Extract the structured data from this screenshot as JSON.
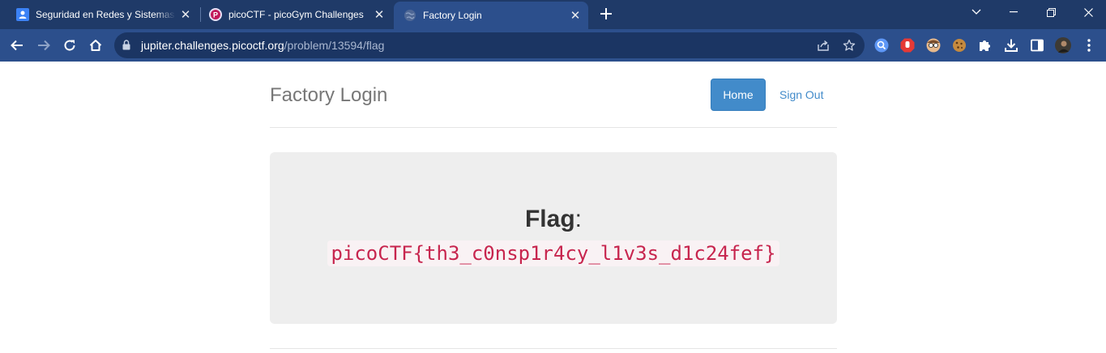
{
  "browser": {
    "tabs": [
      {
        "title": "Seguridad en Redes y Sistemas d",
        "favicon": "classroom-icon",
        "active": false
      },
      {
        "title": "picoCTF - picoGym Challenges",
        "favicon": "picoctf-icon",
        "active": false
      },
      {
        "title": "Factory Login",
        "favicon": "globe-icon",
        "active": true
      }
    ],
    "address": {
      "host": "jupiter.challenges.picoctf.org",
      "path": "/problem/13594/flag"
    },
    "colors": {
      "tabstrip": "#1f3a68",
      "toolbar": "#2c4f8c",
      "omnibox": "#1b3563"
    }
  },
  "page": {
    "brand": "Factory Login",
    "nav": {
      "home_label": "Home",
      "signout_label": "Sign Out"
    },
    "flag_label": "Flag",
    "flag_colon": ":",
    "flag_value": "picoCTF{th3_c0nsp1r4cy_l1v3s_d1c24fef}",
    "colors": {
      "primary": "#428bca",
      "jumbotron": "#eeeeee",
      "code_text": "#c7254e",
      "code_bg": "#f9f2f4"
    }
  }
}
